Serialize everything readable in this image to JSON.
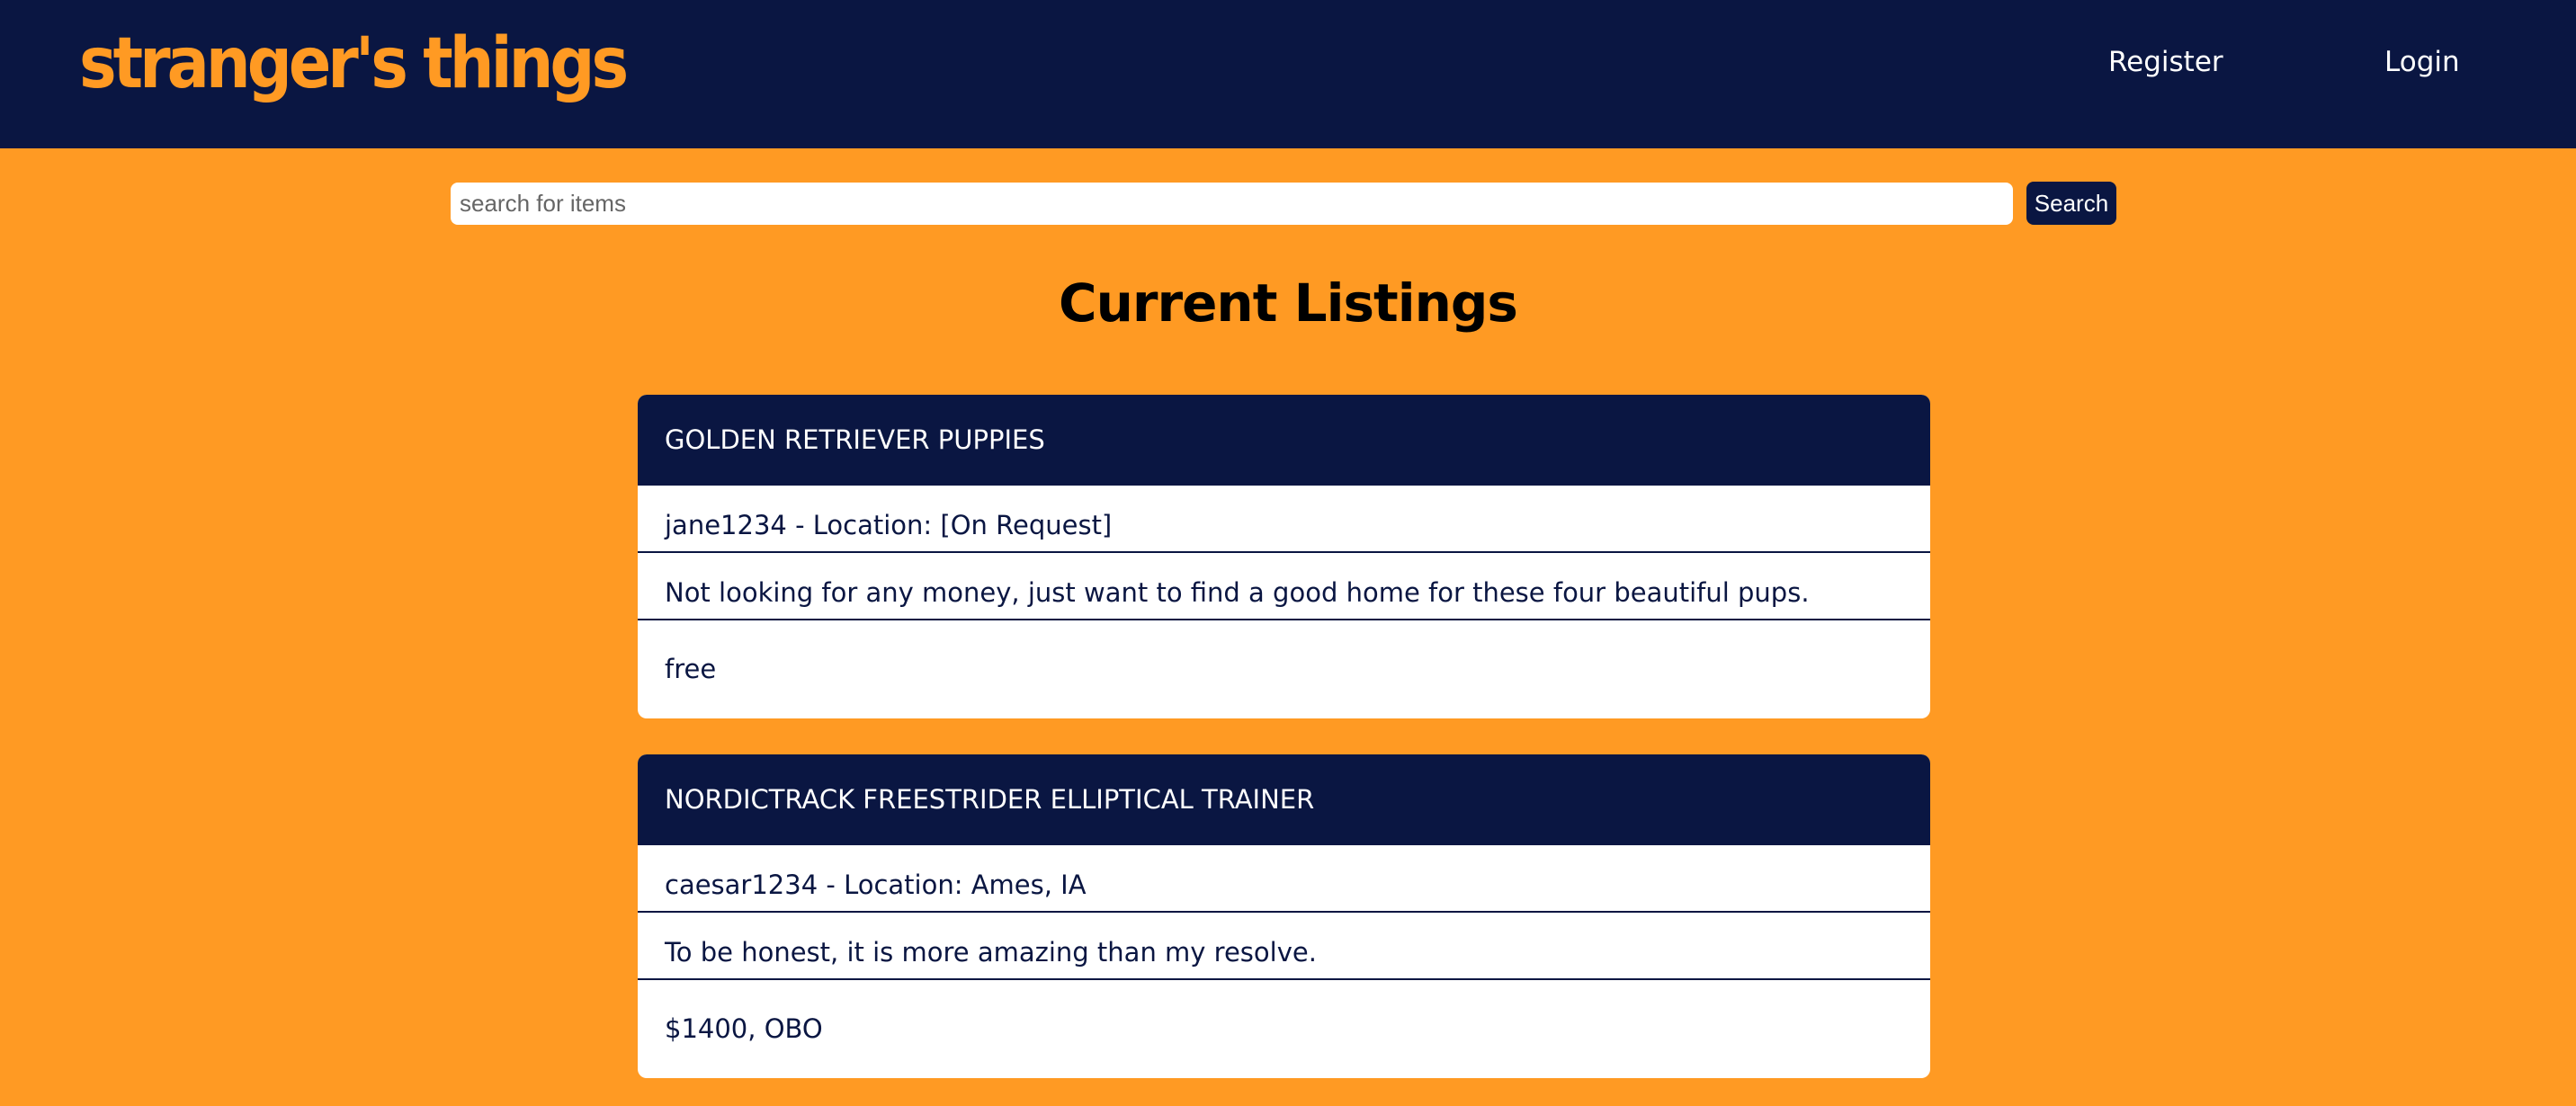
{
  "header": {
    "logo": "stranger's things",
    "nav": {
      "register": "Register",
      "login": "Login"
    }
  },
  "search": {
    "placeholder": "search for items",
    "value": "",
    "button_label": "Search"
  },
  "main": {
    "title": "Current Listings",
    "listings": [
      {
        "title": "GOLDEN RETRIEVER PUPPIES",
        "seller_location": "jane1234 - Location: [On Request]",
        "description": "Not looking for any money, just want to find a good home for these four beautiful pups.",
        "price": "free"
      },
      {
        "title": "NORDICTRACK FREESTRIDER ELLIPTICAL TRAINER",
        "seller_location": "caesar1234 - Location: Ames, IA",
        "description": "To be honest, it is more amazing than my resolve.",
        "price": "$1400, OBO"
      }
    ]
  },
  "colors": {
    "navy": "#0A1642",
    "orange": "#FF9A23",
    "white": "#FFFFFF"
  }
}
